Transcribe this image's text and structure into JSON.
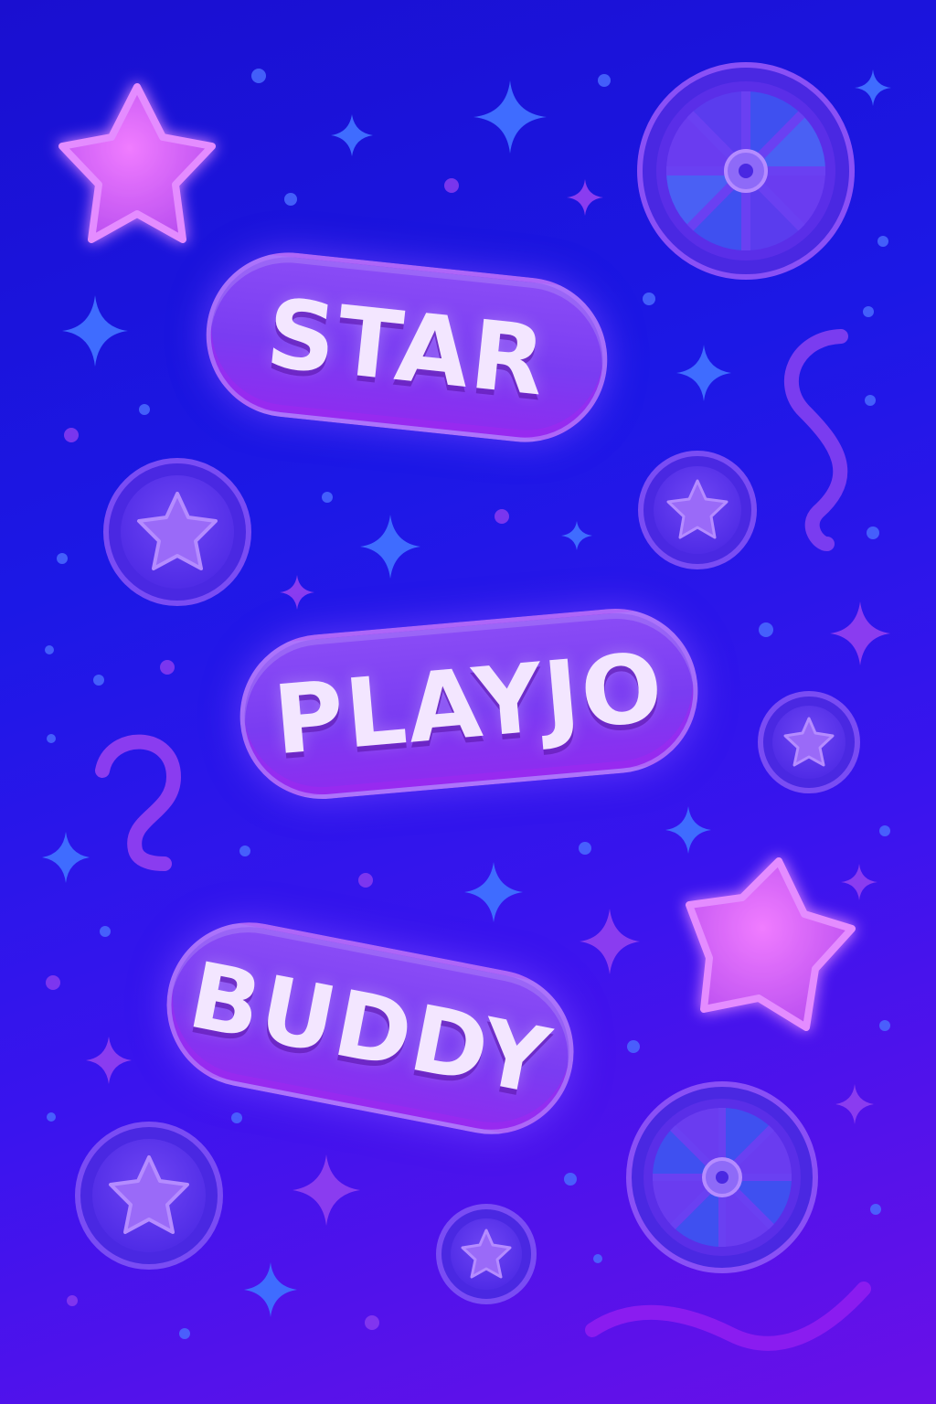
{
  "labels": {
    "word_1": "STAR",
    "word_2": "PLAYJO",
    "word_3": "BUDDY"
  },
  "colors": {
    "background_top": "#1a0fd0",
    "background_bottom": "#6a10e8",
    "pill_fill": "#7a3cf2",
    "label_text": "#f3e6ff",
    "big_star": "#d65cf5",
    "coin": "#6a3cf0",
    "sparkle": "#3f6cff"
  },
  "icons": [
    "star-icon",
    "wheel-icon",
    "coin-star-icon",
    "sparkle-icon",
    "squiggle-icon"
  ]
}
